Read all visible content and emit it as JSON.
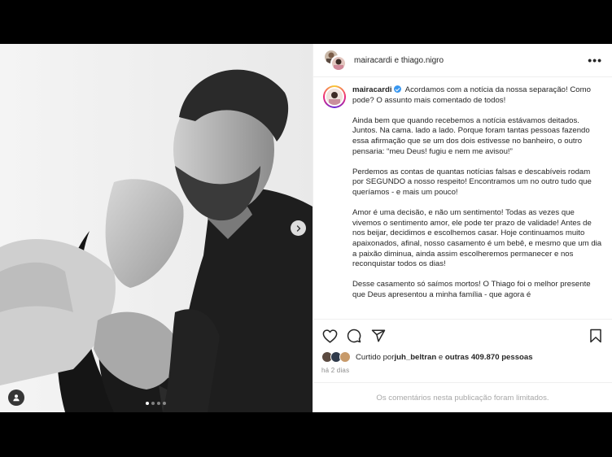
{
  "header": {
    "title_user1": "mairacardi",
    "title_joiner": " e ",
    "title_user2": "thiago.nigro",
    "more_label": "•••"
  },
  "caption": {
    "username": "mairacardi",
    "verified": true,
    "paragraphs": [
      "Acordamos com a notícia da nossa separação! Como pode? O assunto mais comentado de todos!",
      "Ainda bem que quando recebemos a notícia estávamos deitados. Juntos. Na cama. lado a lado. Porque foram tantas pessoas fazendo essa afirmação que se um dos dois estivesse no banheiro, o outro pensaria: “meu Deus! fugiu e nem me avisou!”",
      "Perdemos as contas de quantas notícias falsas e descabíveis rodam por SEGUNDO a nosso respeito! Encontramos um no outro tudo que queríamos - e mais um pouco!",
      "Amor é uma decisão, e não um sentimento! Todas as vezes que vivemos o sentimento amor, ele pode ter prazo de validade! Antes de nos beijar, decidimos e escolhemos casar. Hoje continuamos muito apaixonados, afinal, nosso casamento é um bebê, e mesmo que um dia a paixão diminua, ainda assim escolheremos permanecer e nos reconquistar todos os dias!",
      "Desse casamento só saímos mortos! O Thiago foi o melhor presente que Deus apresentou a minha família - que agora é"
    ]
  },
  "actions": {
    "icons": [
      "heart-icon",
      "comment-icon",
      "share-icon",
      "bookmark-icon"
    ]
  },
  "likes": {
    "prefix": "Curtido por ",
    "user": "juh_beltran",
    "middle": " e ",
    "others": "outras 409.870 pessoas"
  },
  "time": "há 2 dias",
  "comments_limited": "Os comentários nesta publicação foram limitados.",
  "carousel": {
    "total": 4,
    "active": 1
  },
  "colors": {
    "verified": "#3897f0",
    "muted": "#8e8e8e",
    "border": "#efefef"
  }
}
